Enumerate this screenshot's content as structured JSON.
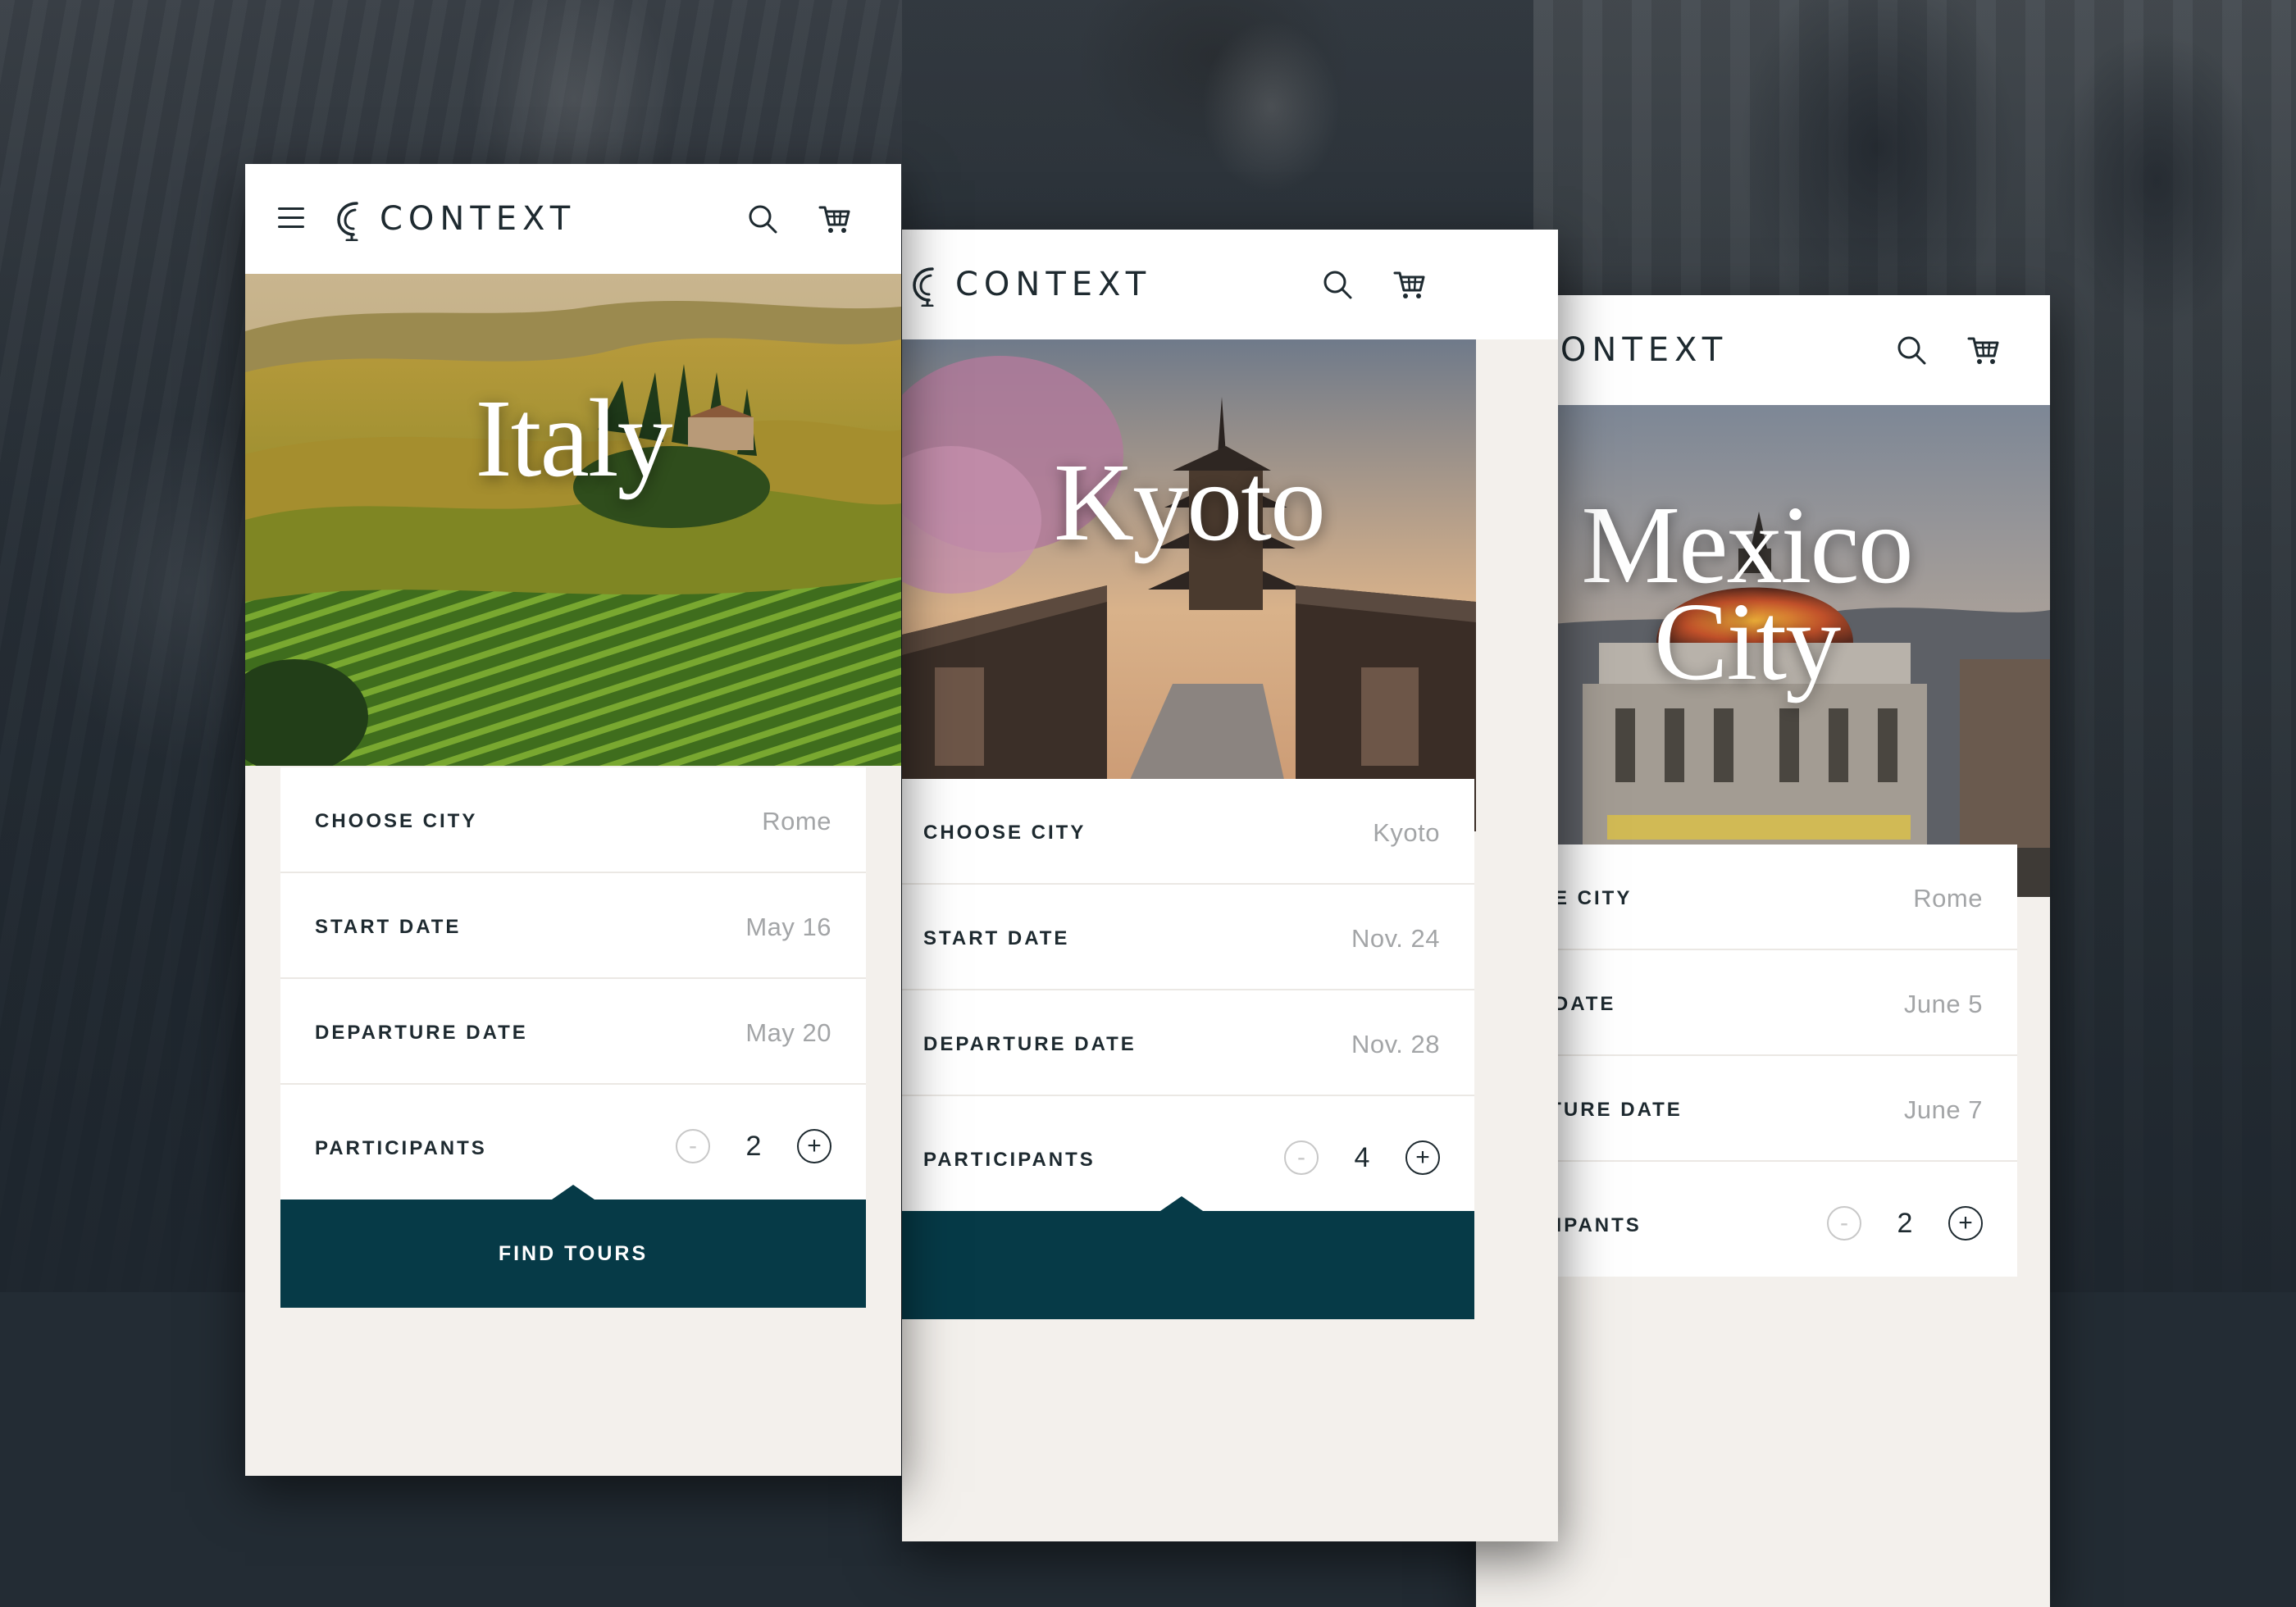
{
  "brand": {
    "name": "CONTEXT"
  },
  "colors": {
    "accent": "#063a47",
    "label": "#1e2a30",
    "muted": "#a3a5a7"
  },
  "icons": {
    "menu": "hamburger-icon",
    "search": "search-icon",
    "cart": "cart-icon",
    "logo": "context-logo-icon"
  },
  "cards": [
    {
      "destination": "Italy",
      "fields": [
        {
          "label": "CHOOSE CITY",
          "value": "Rome"
        },
        {
          "label": "START DATE",
          "value": "May 16"
        },
        {
          "label": "DEPARTURE DATE",
          "value": "May 20"
        }
      ],
      "participants": {
        "label": "PARTICIPANTS",
        "count": "2",
        "minus": "-",
        "plus": "+"
      },
      "cta": "FIND TOURS"
    },
    {
      "destination": "Kyoto",
      "fields": [
        {
          "label": "CHOOSE CITY",
          "value": "Kyoto"
        },
        {
          "label": "START DATE",
          "value": "Nov. 24"
        },
        {
          "label": "DEPARTURE DATE",
          "value": "Nov. 28"
        }
      ],
      "participants": {
        "label": "PARTICIPANTS",
        "count": "4",
        "minus": "-",
        "plus": "+"
      },
      "cta": ""
    },
    {
      "destination_line1": "Mexico",
      "destination_line2": "City",
      "fields": [
        {
          "label": "CHOOSE CITY",
          "value": "Rome"
        },
        {
          "label": "START DATE",
          "value": "June 5"
        },
        {
          "label": "DEPARTURE DATE",
          "value": "June 7"
        }
      ],
      "participants": {
        "label": "PARTICIPANTS",
        "count": "2",
        "minus": "-",
        "plus": "+"
      },
      "cta": ""
    }
  ]
}
